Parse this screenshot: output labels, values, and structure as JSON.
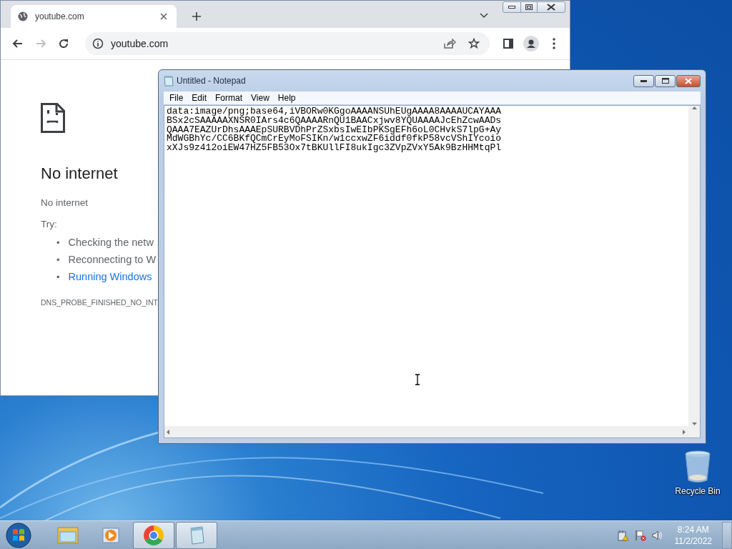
{
  "browser": {
    "tab": {
      "title": "youtube.com"
    },
    "address": "youtube.com",
    "page": {
      "heading": "No internet",
      "subtitle": "No internet",
      "try_label": "Try:",
      "suggestions": [
        {
          "bullet": "•",
          "text": "Checking the netw",
          "kind": "plain"
        },
        {
          "bullet": "•",
          "text": "Reconnecting to W",
          "kind": "plain"
        },
        {
          "bullet": "•",
          "text": "Running Windows",
          "kind": "link"
        }
      ],
      "error_code": "DNS_PROBE_FINISHED_NO_INT"
    }
  },
  "notepad": {
    "title": "Untitled - Notepad",
    "menu": [
      "File",
      "Edit",
      "Format",
      "View",
      "Help"
    ],
    "lines": [
      "data:image/png;base64,iVBORw0KGgoAAAANSUhEUgAAAA8AAAAUCAYAAA",
      "BSx2cSAAAAAXNSR0IArs4c6QAAAARnQU1BAACxjwv8YQUAAAAJcEhZcwAADs",
      "QAAA7EAZUrDhsAAAEpSURBVDhPrZSxbsIwEIbPKSgEFh6oL0CHvkS7lpG+Ay",
      "MdWGBhYc/CC6BKfQCmCrEyMoFSIKn/w1ccxwZF6iddf0fkP58vcVShIYcoio",
      "xXJs9z412oiEW47HZ5FB53Ox7tBKUllFI8ukIgc3ZVpZVxY5Ak9BzHHMtqPl"
    ]
  },
  "desktop_icons": [
    {
      "label": "Recycle Bin"
    }
  ],
  "taskbar": {
    "apps": [
      {
        "kind": "explorer",
        "running": false
      },
      {
        "kind": "media",
        "running": false
      },
      {
        "kind": "chrome",
        "running": true
      },
      {
        "kind": "notepad",
        "running": true
      }
    ],
    "time": "8:24 AM",
    "date": "11/2/2022"
  }
}
